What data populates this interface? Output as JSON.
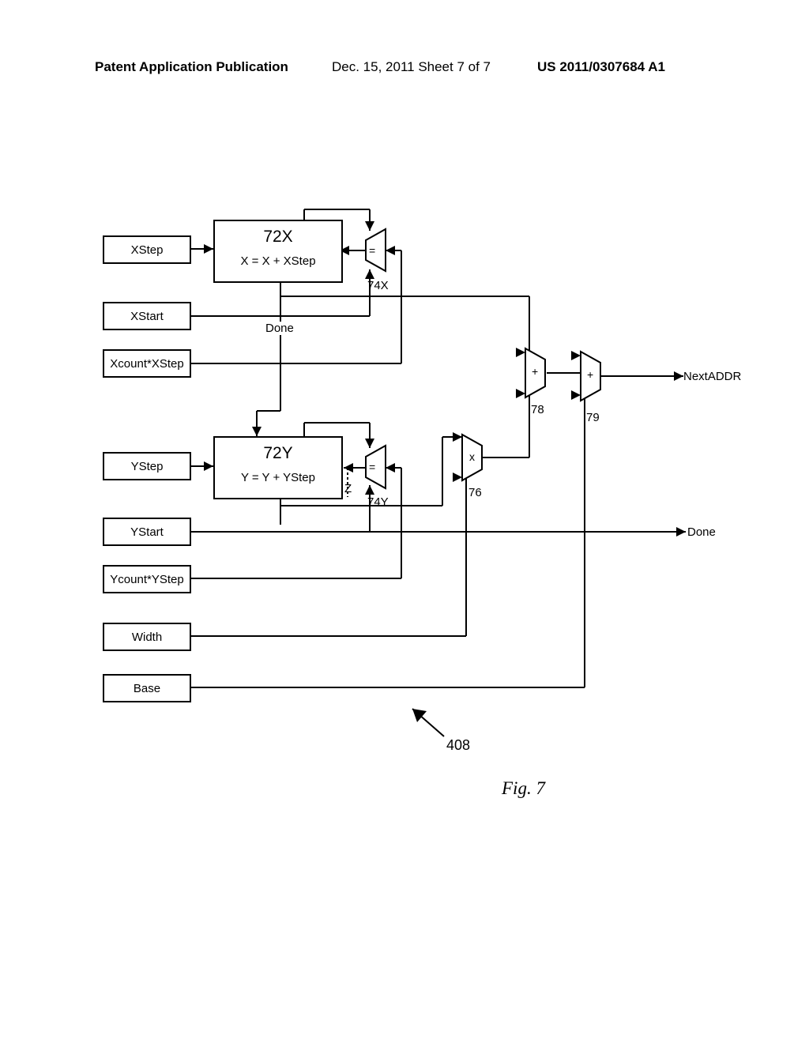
{
  "header": {
    "left": "Patent Application Publication",
    "mid": "Dec. 15, 2011 Sheet 7 of 7",
    "right": "US 2011/0307684 A1"
  },
  "regs": {
    "xstep": "XStep",
    "xstart": "XStart",
    "xcount_xstep": "Xcount*XStep",
    "ystep": "YStep",
    "ystart": "YStart",
    "ycount_ystep": "Ycount*YStep",
    "width": "Width",
    "base": "Base"
  },
  "blocks": {
    "x72": {
      "id": "72X",
      "eq": "X = X + XStep"
    },
    "y72": {
      "id": "72Y",
      "eq": "Y = Y + YStep"
    }
  },
  "labels": {
    "done_mid": "Done",
    "mux74x_ref": "74X",
    "mux74y_ref": "74Y",
    "mux76_ref": "76",
    "mux78_ref": "78",
    "mux79_ref": "79",
    "nextaddr": "NextADDR",
    "done_out": "Done",
    "z_label": "Z",
    "eq_74x": "=",
    "eq_74y": "=",
    "plus_78": "+",
    "plus_79": "+",
    "x_76": "x",
    "ref408": "408"
  },
  "figcaption": "Fig. 7"
}
